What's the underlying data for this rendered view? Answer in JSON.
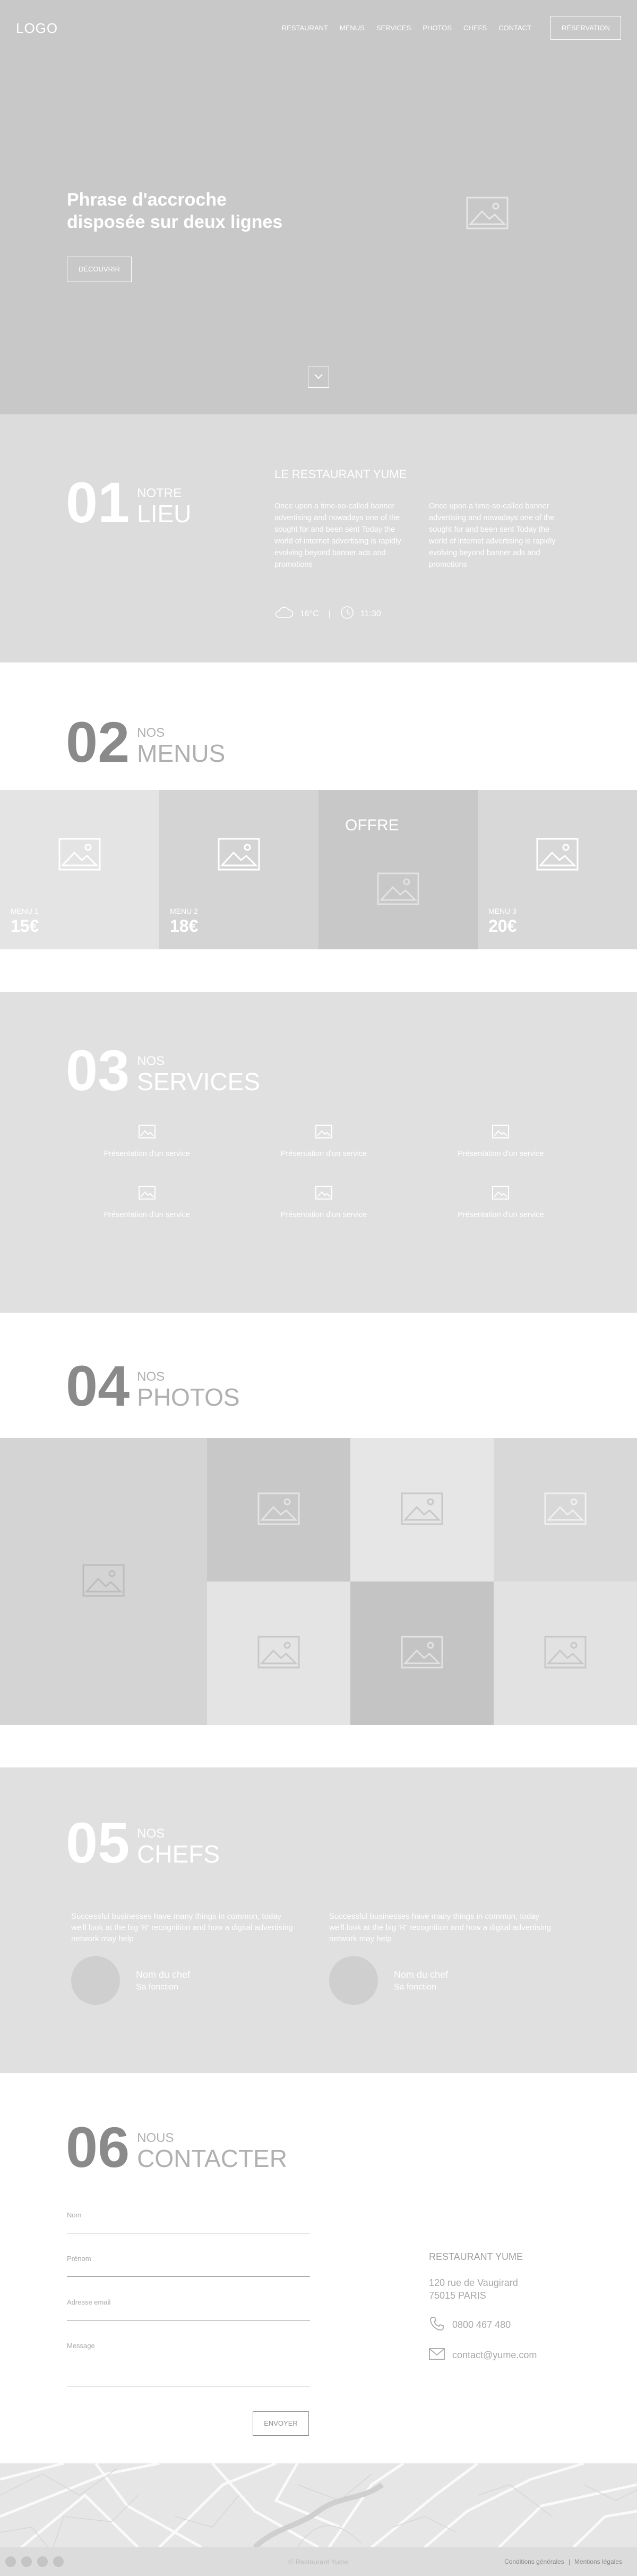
{
  "header": {
    "logo": "LOGO",
    "nav": [
      "RESTAURANT",
      "MENUS",
      "SERVICES",
      "PHOTOS",
      "CHEFS",
      "CONTACT"
    ],
    "cta": "RÉSERVATION"
  },
  "hero": {
    "title": "Phrase d'accroche disposée sur deux lignes",
    "button": "DÉCOUVRIR"
  },
  "lieu": {
    "num": "01",
    "small": "NOTRE",
    "big": "LIEU",
    "title": "LE RESTAURANT YUME",
    "col1": "Once upon a time-so-called banner advertising and nowadays one of the sought for and been sent Today the world of internet advertising is rapidly evolving beyond banner ads and promotions",
    "col2": "Once upon a time-so-called banner advertising and nowadays one of the sought for and been sent Today the world of internet advertising is rapidly evolving beyond banner ads and promotions",
    "weather": "16°C",
    "time": "11:30"
  },
  "menus": {
    "num": "02",
    "small": "NOS",
    "big": "MENUS",
    "items": [
      {
        "name": "MENU 1",
        "price": "15€"
      },
      {
        "name": "MENU 2",
        "price": "18€"
      },
      {
        "offer": "OFFRE"
      },
      {
        "name": "MENU 3",
        "price": "20€"
      }
    ]
  },
  "services": {
    "num": "03",
    "small": "NOS",
    "big": "SERVICES",
    "items": [
      "Présentation d'un service",
      "Présentation d'un service",
      "Présentation d'un service",
      "Présentation d'un service",
      "Présentation d'un service",
      "Présentation d'un service"
    ]
  },
  "photos": {
    "num": "04",
    "small": "NOS",
    "big": "PHOTOS"
  },
  "chefs": {
    "num": "05",
    "small": "NOS",
    "big": "CHEFS",
    "items": [
      {
        "quote": "Successful businesses have many things in common, today we'll look at the big 'R' recognition and how a digital advertising network may help",
        "name": "Nom du chef",
        "role": "Sa fonction"
      },
      {
        "quote": "Successful businesses have many things in common, today we'll look at the big 'R' recognition and how a digital advertising network may help",
        "name": "Nom du chef",
        "role": "Sa fonction"
      }
    ]
  },
  "contact": {
    "num": "06",
    "small": "NOUS",
    "big": "CONTACTER",
    "fields": [
      "Nom",
      "Prénom",
      "Adresse email",
      "Message"
    ],
    "send": "ENVOYER",
    "name": "RESTAURANT YUME",
    "address1": "120 rue de Vaugirard",
    "address2": "75015 PARIS",
    "phone": "0800 467 480",
    "email": "contact@yume.com"
  },
  "footer": {
    "copyright": "© Restaurant Yume",
    "legal1": "Conditions générales",
    "legal2": "Mentions légales"
  },
  "colors": {
    "placeholder_dark": "#c8c8c8",
    "placeholder_light": "#e0e0e0",
    "text_grey": "#8a8a8a"
  }
}
